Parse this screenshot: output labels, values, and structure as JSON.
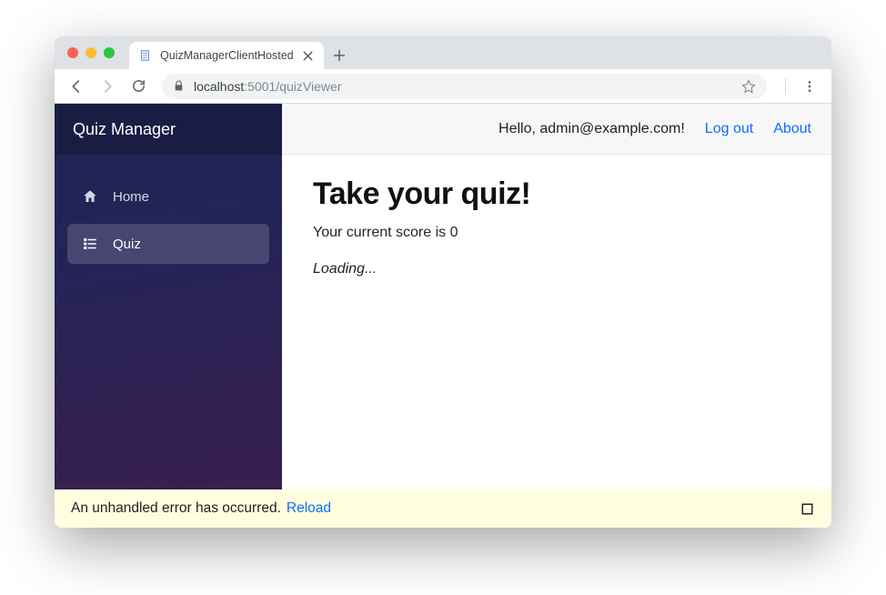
{
  "browser": {
    "tab_title": "QuizManagerClientHosted",
    "url_host": "localhost",
    "url_port": ":5001",
    "url_path": "/quizViewer"
  },
  "sidebar": {
    "brand": "Quiz Manager",
    "items": [
      {
        "label": "Home",
        "icon": "home-icon",
        "active": false
      },
      {
        "label": "Quiz",
        "icon": "list-icon",
        "active": true
      }
    ]
  },
  "topbar": {
    "greeting": "Hello, admin@example.com!",
    "logout_label": "Log out",
    "about_label": "About"
  },
  "main": {
    "title": "Take your quiz!",
    "score_prefix": "Your current score is ",
    "score_value": "0",
    "loading_text": "Loading..."
  },
  "error_banner": {
    "message": "An unhandled error has occurred. ",
    "reload_label": "Reload"
  }
}
